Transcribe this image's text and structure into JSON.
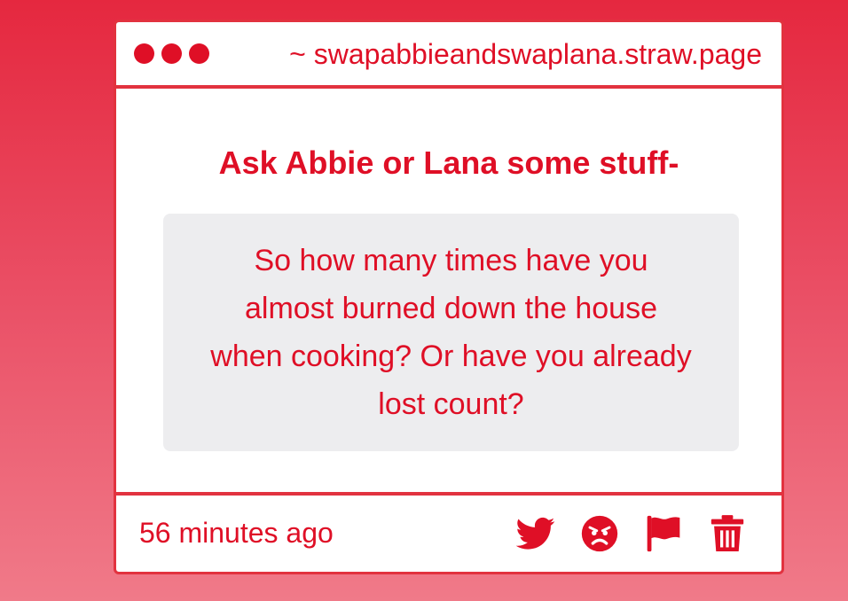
{
  "browser": {
    "url": "~ swapabbieandswaplana.straw.page"
  },
  "question": {
    "title": "Ask Abbie or Lana some stuff-",
    "text": "So how many times have you almost burned down the house when cooking? Or have you already lost count?"
  },
  "footer": {
    "timestamp": "56 minutes ago",
    "actions": [
      "twitter-icon",
      "angry-face-icon",
      "flag-icon",
      "trash-icon"
    ]
  },
  "colors": {
    "accent": "#df0f26",
    "background_top": "#e5283f",
    "background_bottom": "#f07a89",
    "question_box": "#ededef"
  }
}
